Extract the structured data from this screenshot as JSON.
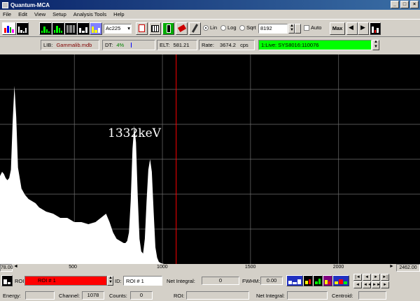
{
  "window": {
    "title": "Quantum-MCA"
  },
  "menu": [
    "File",
    "Edit",
    "View",
    "Setup",
    "Analysis Tools",
    "Help"
  ],
  "toolbar": {
    "isotope": "Ac225",
    "scale_modes": [
      "Lin",
      "Log",
      "Sqrt"
    ],
    "selected_scale": "Lin",
    "channels": "8192",
    "auto_label": "Auto",
    "max_label": "Max"
  },
  "info": {
    "lib_label": "LIB:",
    "lib_value": "Gammalib.mdb",
    "dt_label": "DT:",
    "dt_value": "4%",
    "elt_label": "ELT:",
    "elt_value": "581.21",
    "rate_label": "Rate:",
    "rate_value": "3674.2",
    "rate_unit": "cps",
    "live_status": "1:Live: SYS8016:110076"
  },
  "chart_data": {
    "type": "area",
    "annotation": "1332keV",
    "x_ticks": [
      "500",
      "1000",
      "1500",
      "2000"
    ],
    "x_range": [
      78,
      2462
    ],
    "range_start_label": "78.00",
    "range_end_label": "2462.00",
    "cursor_channel": 1078,
    "x": [
      78,
      90,
      100,
      110,
      120,
      130,
      140,
      150,
      160,
      170,
      180,
      200,
      220,
      240,
      260,
      280,
      300,
      340,
      380,
      420,
      460,
      500,
      540,
      580,
      620,
      650,
      680,
      700,
      720,
      740,
      760,
      780,
      790,
      800,
      810,
      820,
      830,
      840,
      850,
      860,
      870,
      880,
      890,
      900,
      910,
      920,
      930,
      940,
      950,
      960,
      970,
      980,
      990,
      1000,
      1010
    ],
    "y": [
      0.42,
      0.44,
      0.43,
      0.41,
      0.4,
      0.41,
      0.45,
      0.68,
      0.85,
      0.7,
      0.46,
      0.36,
      0.33,
      0.31,
      0.3,
      0.29,
      0.27,
      0.25,
      0.24,
      0.22,
      0.22,
      0.2,
      0.2,
      0.19,
      0.2,
      0.22,
      0.24,
      0.2,
      0.15,
      0.12,
      0.11,
      0.1,
      0.1,
      0.11,
      0.15,
      0.3,
      0.55,
      0.66,
      0.58,
      0.32,
      0.12,
      0.06,
      0.05,
      0.12,
      0.3,
      0.45,
      0.5,
      0.44,
      0.25,
      0.08,
      0.03,
      0.01,
      0.005,
      0.002,
      0.0
    ],
    "grid": true
  },
  "roi": {
    "roi_label": "ROI:",
    "roi_value": "ROI # 1",
    "id_label": "ID:",
    "id_value": "ROI # 1",
    "net_integral_label": "Net Integral:",
    "net_integral_value": "0",
    "fwhm_label": "FWHM:",
    "fwhm_value": "0.00"
  },
  "status": {
    "energy_label": "Energy:",
    "energy_value": "",
    "channel_label": "Channel:",
    "channel_value": "1078",
    "counts_label": "Counts:",
    "counts_value": "0",
    "roi_label": "ROI:",
    "roi_value": "",
    "net_integral_label": "Net Integral:",
    "net_integral_value": "",
    "centroid_label": "Centroid:",
    "centroid_value": ""
  },
  "colors": {
    "live_bg": "#00ff00",
    "roi_bg": "#ff0000",
    "cursor": "#ff0000",
    "spectrum": "#ffffff",
    "plot_bg": "#000000"
  }
}
